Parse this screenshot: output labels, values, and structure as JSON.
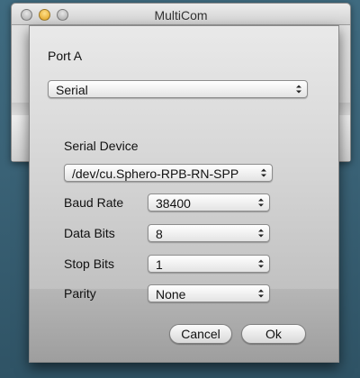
{
  "window": {
    "title": "MultiCom"
  },
  "dialog": {
    "heading": "Port A",
    "port_type": {
      "selected": "Serial"
    },
    "serial_device": {
      "label": "Serial Device",
      "selected": "/dev/cu.Sphero-RPB-RN-SPP"
    },
    "baud_rate": {
      "label": "Baud Rate",
      "selected": "38400"
    },
    "data_bits": {
      "label": "Data Bits",
      "selected": "8"
    },
    "stop_bits": {
      "label": "Stop Bits",
      "selected": "1"
    },
    "parity": {
      "label": "Parity",
      "selected": "None"
    },
    "buttons": {
      "cancel": "Cancel",
      "ok": "Ok"
    }
  },
  "icons": {
    "close": "close-icon",
    "minimize": "minimize-icon",
    "zoom": "zoom-icon",
    "popup_arrows": "up-down-chevron-icon"
  },
  "colors": {
    "desktop": "#3a6276",
    "dialog_top": "#e9e9e9",
    "dialog_bottom": "#9e9e9e",
    "minimize_yellow": "#e2a11b"
  }
}
